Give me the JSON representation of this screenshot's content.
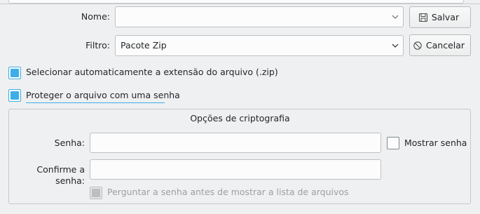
{
  "form": {
    "name_label": "Nome:",
    "name_value": "",
    "filter_label": "Filtro:",
    "filter_value": "Pacote Zip",
    "save_button": "Salvar",
    "cancel_button": "Cancelar"
  },
  "options": {
    "auto_extension": {
      "label": "Selecionar automaticamente a extensão do arquivo (.zip)",
      "checked": true
    },
    "protect_password": {
      "label": "Proteger o arquivo com uma senha",
      "checked": true
    }
  },
  "encryption": {
    "group_title": "Opções de criptografia",
    "password_label": "Senha:",
    "password_value": "",
    "show_password_label": "Mostrar senha",
    "show_password_checked": false,
    "confirm_label": "Confirme a senha:",
    "confirm_value": "",
    "ask_before_list_label": "Perguntar a senha antes de mostrar a lista de arquivos",
    "ask_before_list_checked": true,
    "ask_before_list_enabled": false
  },
  "colors": {
    "accent": "#3daee9",
    "background": "#eff0f1",
    "text": "#232629",
    "disabled_text": "#9c9fa2"
  },
  "icons": {
    "save": "floppy-disk-icon",
    "cancel": "cancel-circle-icon",
    "dropdown": "chevron-down-icon"
  }
}
